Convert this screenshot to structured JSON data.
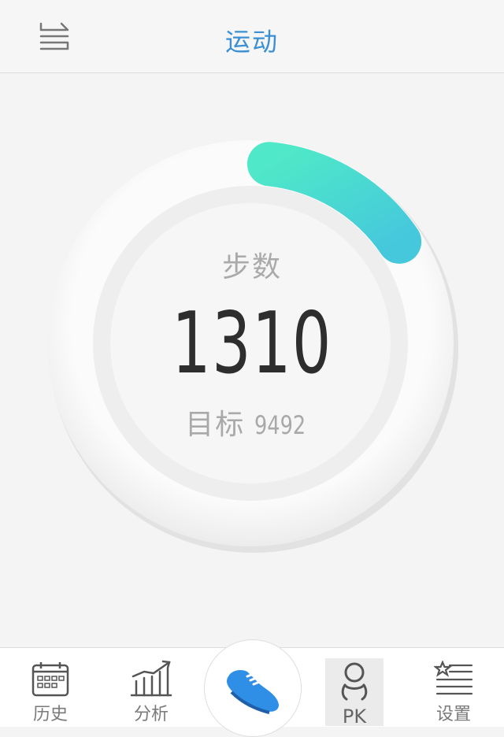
{
  "header": {
    "title": "运动",
    "switch_icon": "switch-arrows-icon"
  },
  "activity": {
    "steps_label": "步数",
    "steps_value": "1310",
    "goal_label": "目标",
    "goal_value": "9492",
    "progress_fraction": 0.138
  },
  "tabs": [
    {
      "label": "历史",
      "icon": "calendar-icon"
    },
    {
      "label": "分析",
      "icon": "chart-icon"
    },
    {
      "label": "",
      "icon": "sneaker-icon"
    },
    {
      "label": "PK",
      "icon": "person-icon"
    },
    {
      "label": "设置",
      "icon": "settings-list-icon"
    }
  ],
  "colors": {
    "title": "#3b8fd3",
    "progress_start": "#4fe8c8",
    "progress_end": "#45c8dc",
    "sneaker": "#2f8fe6"
  }
}
